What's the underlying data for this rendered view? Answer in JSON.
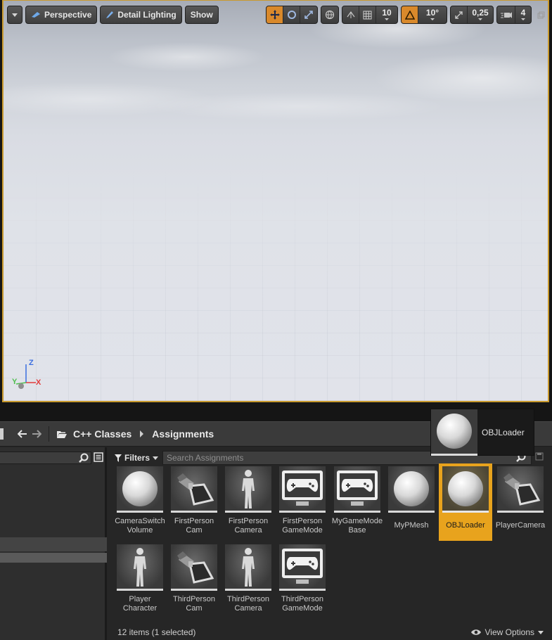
{
  "viewport": {
    "view_mode": "Perspective",
    "lighting_mode": "Detail Lighting",
    "show_label": "Show",
    "grid_snap_value": "10",
    "rotation_snap_value": "10°",
    "scale_snap_value": "0,25",
    "camera_speed_value": "4",
    "axis_labels": {
      "z": "Z",
      "y": "Y",
      "x": "X"
    },
    "accent_color": "#c99a2e"
  },
  "content_browser": {
    "path": {
      "folder": "C++ Classes",
      "subfolder": "Assignments"
    },
    "filters_label": "Filters",
    "search_placeholder": "Search Assignments",
    "assets": [
      {
        "label": "CameraSwitch Volume",
        "icon": "sphere"
      },
      {
        "label": "FirstPerson Cam",
        "icon": "camera"
      },
      {
        "label": "FirstPerson Camera",
        "icon": "mannequin"
      },
      {
        "label": "FirstPerson GameMode",
        "icon": "gamepad-monitor"
      },
      {
        "label": "MyGameMode Base",
        "icon": "gamepad-monitor"
      },
      {
        "label": "MyPMesh",
        "icon": "sphere"
      },
      {
        "label": "OBJLoader",
        "icon": "sphere",
        "selected": true
      },
      {
        "label": "PlayerCamera",
        "icon": "camera"
      },
      {
        "label": "Player Character",
        "icon": "mannequin"
      },
      {
        "label": "ThirdPerson Cam",
        "icon": "camera"
      },
      {
        "label": "ThirdPerson Camera",
        "icon": "mannequin"
      },
      {
        "label": "ThirdPerson GameMode",
        "icon": "gamepad-monitor"
      }
    ],
    "status": "12 items (1 selected)",
    "view_options_label": "View Options",
    "selection_color": "#e8a31d"
  },
  "tooltip": {
    "label": "OBJLoader",
    "icon": "sphere"
  }
}
